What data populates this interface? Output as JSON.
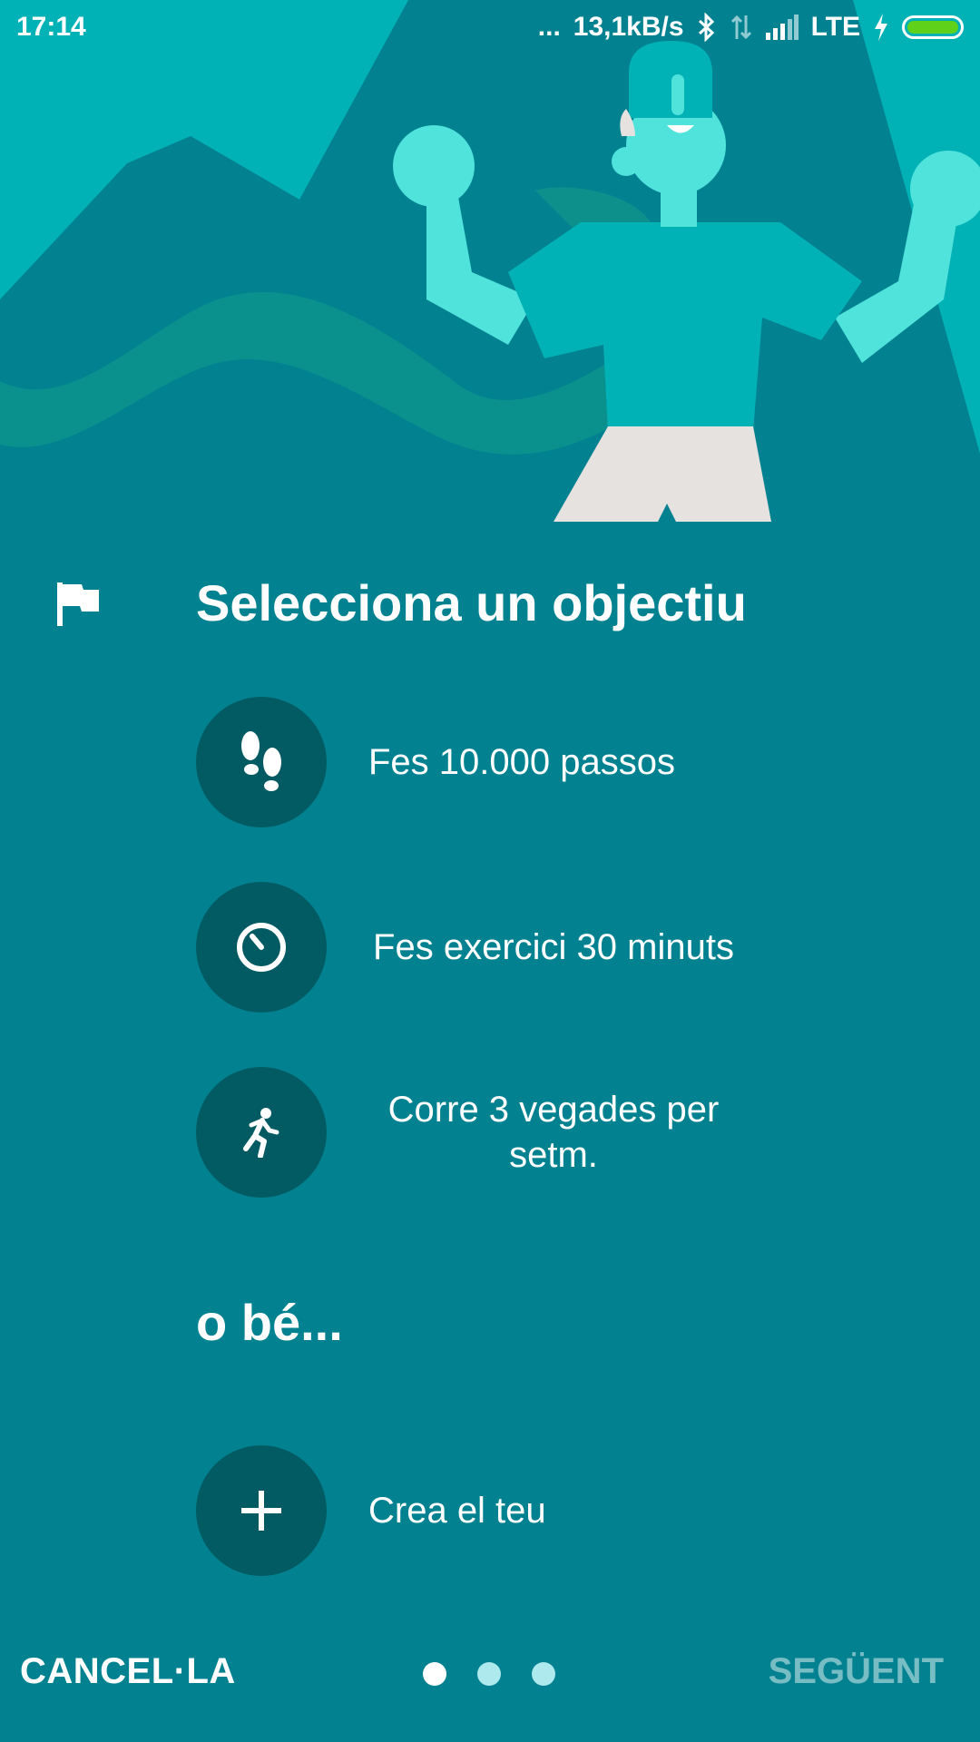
{
  "status_bar": {
    "time": "17:14",
    "dots": "...",
    "speed": "13,1kB/s",
    "network": "LTE"
  },
  "main": {
    "title": "Selecciona un objectiu",
    "goals": [
      {
        "label": "Fes 10.000 passos",
        "icon": "footsteps-icon"
      },
      {
        "label": "Fes exercici 30 minuts",
        "icon": "timer-icon"
      },
      {
        "label": "Corre 3 vegades per setm.",
        "icon": "running-person-icon"
      }
    ],
    "or_text": "o bé...",
    "custom": {
      "label": "Crea el teu",
      "icon": "plus-icon"
    }
  },
  "footer": {
    "cancel_label": "CANCEL·LA",
    "next_label": "SEGÜENT",
    "page_indicator": {
      "count": 3,
      "active": 1
    }
  },
  "colors": {
    "background": "#028290",
    "circle": "#025b62",
    "accent_light": "#4fe3dc",
    "next_disabled": "#78bdc4"
  }
}
